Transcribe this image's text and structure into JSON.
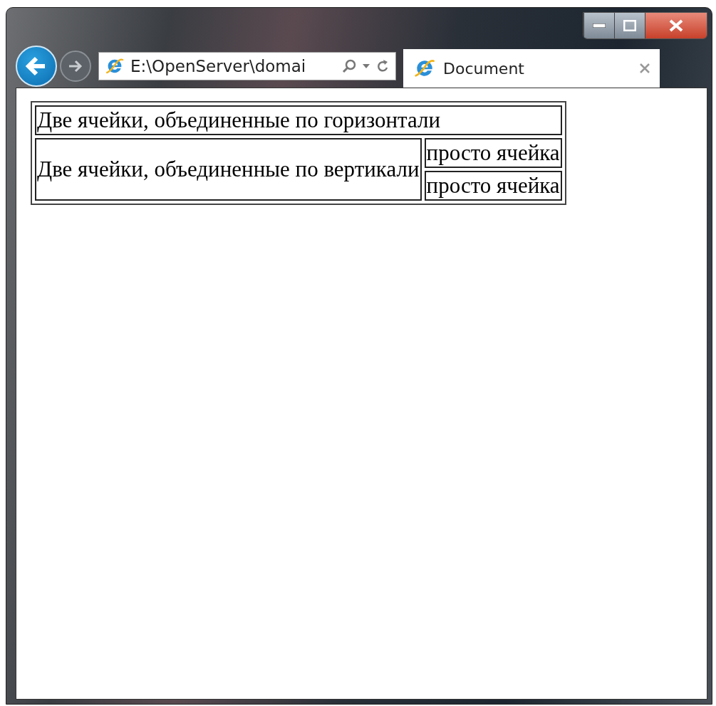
{
  "browser": {
    "address": "E:\\OpenServer\\domai",
    "tab_title": "Document"
  },
  "table": {
    "merged_row": "Две ячейки, объединенные по горизонтали",
    "merged_column": "Две ячейки, объединенные по вертикали",
    "cells": [
      "просто ячейка",
      "просто ячейка"
    ]
  }
}
